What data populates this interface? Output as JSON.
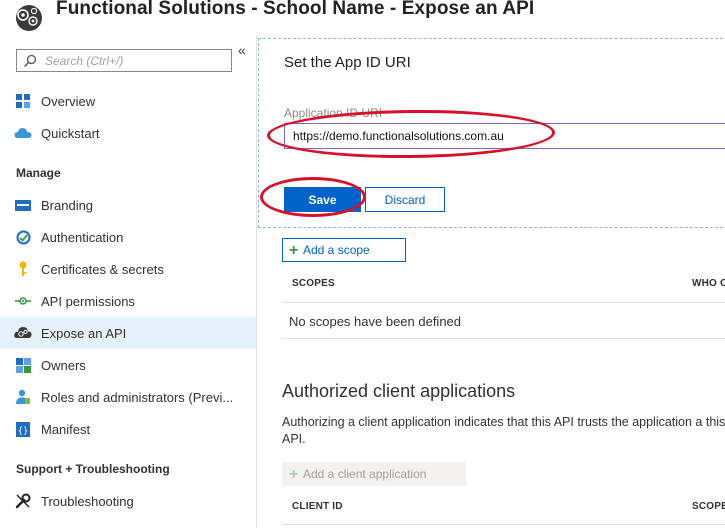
{
  "window": {
    "title": "Functional Solutions - School Name - Expose an API"
  },
  "sidebar": {
    "collapse_glyph": "«",
    "search": {
      "placeholder": "Search (Ctrl+/)"
    },
    "top_items": [
      {
        "label": "Overview",
        "icon": "overview-icon"
      },
      {
        "label": "Quickstart",
        "icon": "quickstart-cloud-icon"
      }
    ],
    "manage_heading": "Manage",
    "manage_items": [
      {
        "label": "Branding",
        "icon": "branding-icon"
      },
      {
        "label": "Authentication",
        "icon": "authentication-icon"
      },
      {
        "label": "Certificates & secrets",
        "icon": "key-icon"
      },
      {
        "label": "API permissions",
        "icon": "api-permissions-icon"
      },
      {
        "label": "Expose an API",
        "icon": "expose-api-cloud-icon",
        "active": true
      },
      {
        "label": "Owners",
        "icon": "owners-icon"
      },
      {
        "label": "Roles and administrators (Previ...",
        "icon": "roles-icon"
      },
      {
        "label": "Manifest",
        "icon": "manifest-icon"
      }
    ],
    "support_heading": "Support + Troubleshooting",
    "support_items": [
      {
        "label": "Troubleshooting",
        "icon": "wrench-icon"
      }
    ]
  },
  "panel": {
    "title": "Set the App ID URI",
    "field_label": "Application ID URI",
    "uri_value": "https://demo.functionalsolutions.com.au",
    "save_label": "Save",
    "discard_label": "Discard"
  },
  "scopes": {
    "add_button": "Add a scope",
    "columns": [
      "SCOPES",
      "WHO C"
    ],
    "empty_text": "No scopes have been defined"
  },
  "authorized_clients": {
    "title": "Authorized client applications",
    "description": "Authorizing a client application indicates that this API trusts the application a this API.",
    "add_button": "Add a client application",
    "columns": [
      "CLIENT ID",
      "SCOPES"
    ]
  },
  "colors": {
    "accent": "#0063c9",
    "annotation": "#d8102a",
    "active_nav": "#e6f0fa"
  }
}
